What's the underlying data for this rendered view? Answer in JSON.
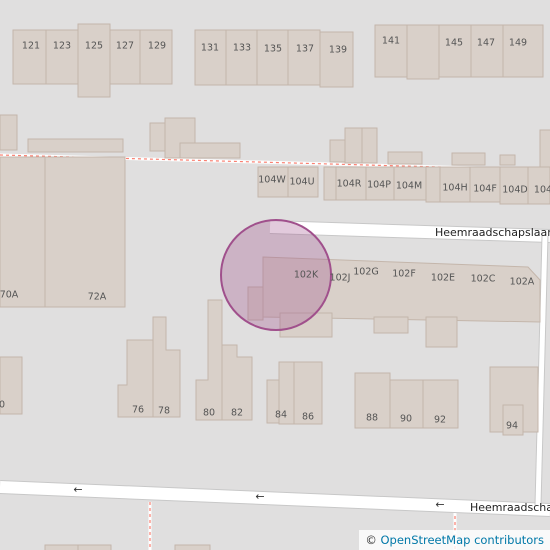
{
  "map": {
    "marker_color": "#a0508c",
    "building_fill": "#d9d0c9",
    "road_color": "#ffffff",
    "background_color": "#e0dfdf",
    "footpath_color": "#fa8072"
  },
  "street_labels": {
    "heemraadschapslaan_upper": "Heemraadschapslaan",
    "heemraadschapslaan_lower": "Heemraadscha"
  },
  "house_numbers": [
    "121",
    "123",
    "125",
    "127",
    "129",
    "131",
    "133",
    "135",
    "137",
    "139",
    "141",
    "145",
    "147",
    "149",
    "104W",
    "104U",
    "104R",
    "104P",
    "104M",
    "104H",
    "104F",
    "104D",
    "104",
    "102K",
    "102J",
    "102G",
    "102F",
    "102E",
    "102C",
    "102A",
    "70A",
    "72A",
    "76",
    "78",
    "80",
    "82",
    "84",
    "86",
    "88",
    "90",
    "92",
    "94",
    "0"
  ],
  "oneway_arrow": "←",
  "attribution": {
    "copyright": "© ",
    "link_text": "OpenStreetMap contributors"
  }
}
